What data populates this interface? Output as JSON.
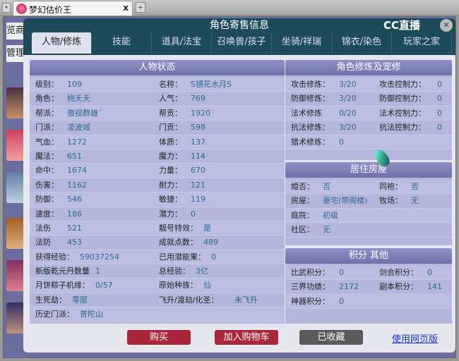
{
  "browser": {
    "tab_title": "梦幻估价王",
    "close": "x",
    "new_tab": "+",
    "dropdown": "▾"
  },
  "background": {
    "text1": "览商",
    "text2": "管理"
  },
  "dialog": {
    "title": "角色寄售信息",
    "logo": "CC直播",
    "close": "✕",
    "tabs": [
      "人物/修炼",
      "技能",
      "道具/法宝",
      "召唤兽/孩子",
      "坐骑/祥瑞",
      "锦衣/染色",
      "玩家之家"
    ]
  },
  "status": {
    "title": "人物状态",
    "rows": [
      [
        [
          "级别：",
          "109"
        ],
        [
          "名称：",
          "S镜花水月S"
        ]
      ],
      [
        [
          "角色：",
          "桃夭夭"
        ],
        [
          "人气：",
          "769"
        ]
      ],
      [
        [
          "帮派：",
          "傲视群雄´"
        ],
        [
          "帮贡：",
          "1920"
        ]
      ],
      [
        [
          "门派：",
          "凌波城"
        ],
        [
          "门贡：",
          "598"
        ]
      ],
      [
        [
          "气血：",
          "1272"
        ],
        [
          "体质：",
          "137"
        ]
      ],
      [
        [
          "魔法：",
          "651"
        ],
        [
          "魔力：",
          "114"
        ]
      ],
      [
        [
          "命中：",
          "1674"
        ],
        [
          "力量：",
          "670"
        ]
      ],
      [
        [
          "伤害：",
          "1162"
        ],
        [
          "耐力：",
          "121"
        ]
      ],
      [
        [
          "防御：",
          "546"
        ],
        [
          "敏捷：",
          "119"
        ]
      ],
      [
        [
          "速度：",
          "186"
        ],
        [
          "潜力：",
          "0"
        ]
      ],
      [
        [
          "法伤",
          "521"
        ],
        [
          "靓号特效：",
          "是"
        ]
      ],
      [
        [
          "法防",
          "453"
        ],
        [
          "成就点数：",
          "489"
        ]
      ],
      [
        [
          "获得经验：",
          "59037254"
        ],
        [
          "已用潜能果：",
          "0"
        ]
      ],
      [
        [
          "新版乾元丹数量",
          "1"
        ],
        [
          "总经验：",
          "3亿"
        ]
      ],
      [
        [
          "月饼粽子机缘：",
          "0/57"
        ],
        [
          "原始种族：",
          "仙"
        ]
      ],
      [
        [
          "生死劫：",
          "零层"
        ],
        [
          "飞升/渡劫/化圣：",
          "未飞升"
        ]
      ],
      [
        [
          "历史门派：",
          "普陀山"
        ]
      ]
    ]
  },
  "cultivation": {
    "title": "角色修炼及宠修",
    "rows": [
      [
        [
          "攻击修炼：",
          "3/20"
        ],
        [
          "攻击控制力：",
          "0"
        ]
      ],
      [
        [
          "防御修炼：",
          "3/20"
        ],
        [
          "防御控制力：",
          "0"
        ]
      ],
      [
        [
          "法术修炼",
          "0/20"
        ],
        [
          "法术控制力：",
          "0"
        ]
      ],
      [
        [
          "抗法修炼：",
          "3/20"
        ],
        [
          "抗法控制力：",
          "0"
        ]
      ],
      [
        [
          "猎术修炼：",
          "0"
        ]
      ]
    ]
  },
  "house": {
    "title": "居住房屋",
    "rows": [
      [
        [
          "婚否：",
          "否"
        ],
        [
          "同袍：",
          "否"
        ]
      ],
      [
        [
          "房屋：",
          "豪宅(带阁楼)"
        ],
        [
          "牧场：",
          "无"
        ]
      ],
      [
        [
          "庭院：",
          "初级"
        ]
      ],
      [
        [
          "社区：",
          "无"
        ]
      ]
    ]
  },
  "points": {
    "title": "积分 其他",
    "rows": [
      [
        [
          "比武积分：",
          "0"
        ],
        [
          "剑会积分：",
          "0"
        ]
      ],
      [
        [
          "三界功绩：",
          "2172"
        ],
        [
          "副本积分：",
          "141"
        ]
      ],
      [
        [
          "神器积分：",
          "0"
        ]
      ]
    ]
  },
  "actions": {
    "buy": "购买",
    "add_cart": "加入购物车",
    "collected": "已收藏",
    "web_version": "使用网页版"
  },
  "colors": {
    "header": "#1e4b5a",
    "buy": "#a8283a",
    "collected": "#5a5a5a"
  }
}
